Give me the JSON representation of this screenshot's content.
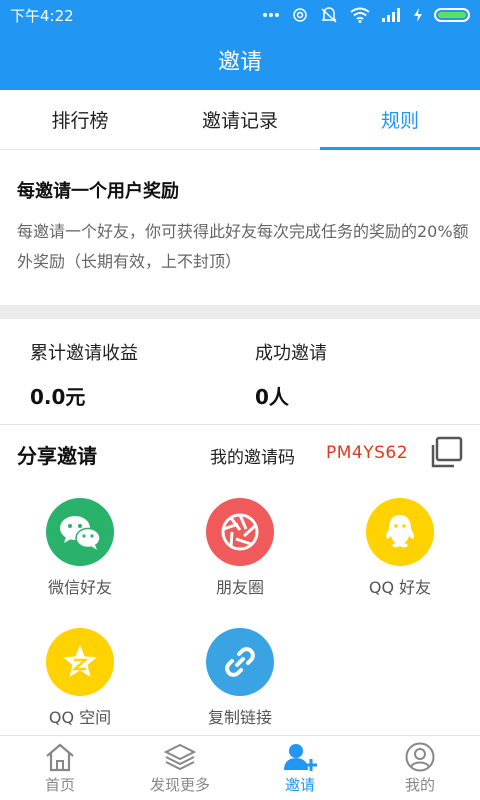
{
  "status_bar": {
    "time": "下午4:22"
  },
  "header": {
    "title": "邀请"
  },
  "tabs": [
    {
      "label": "排行榜"
    },
    {
      "label": "邀请记录"
    },
    {
      "label": "规则"
    }
  ],
  "rule": {
    "title": "每邀请一个用户奖励",
    "description": "每邀请一个好友，你可获得此好友每次完成任务的奖励的20%额外奖励（长期有效，上不封顶）"
  },
  "stats": {
    "earnings_label": "累计邀请收益",
    "earnings_value": "0.0元",
    "success_label": "成功邀请",
    "success_value": "0人"
  },
  "share": {
    "title": "分享邀请",
    "code_label": "我的邀请码",
    "code_value": "PM4YS62",
    "items": [
      {
        "label": "微信好友",
        "icon": "wechat-icon",
        "color": "#2ab26b"
      },
      {
        "label": "朋友圈",
        "icon": "moments-icon",
        "color": "#f05a5a"
      },
      {
        "label": "QQ 好友",
        "icon": "qq-icon",
        "color": "#ffd200"
      },
      {
        "label": "QQ 空间",
        "icon": "qzone-icon",
        "color": "#ffd200"
      },
      {
        "label": "复制链接",
        "icon": "link-icon",
        "color": "#3aa3e3"
      }
    ]
  },
  "bottom_nav": [
    {
      "label": "首页",
      "icon": "home-icon"
    },
    {
      "label": "发现更多",
      "icon": "layers-icon"
    },
    {
      "label": "邀请",
      "icon": "add-user-icon"
    },
    {
      "label": "我的",
      "icon": "profile-icon"
    }
  ],
  "colors": {
    "accent": "#2196f3",
    "code": "#e0391f"
  }
}
